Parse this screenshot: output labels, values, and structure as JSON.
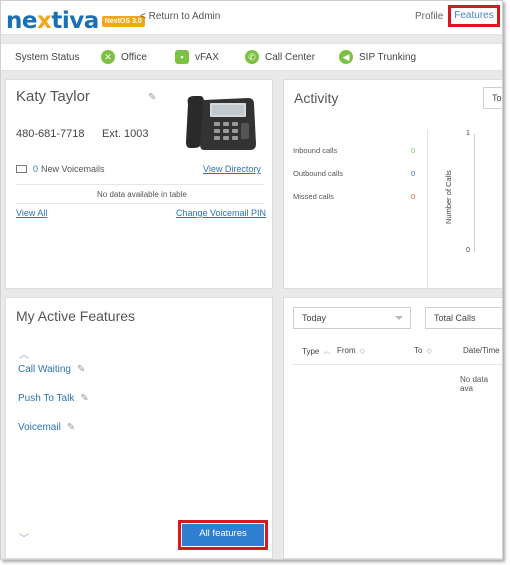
{
  "header": {
    "logo_text_1": "ne",
    "logo_text_x": "x",
    "logo_text_2": "tiva",
    "logo_badge": "NextOS 3.0",
    "return_link": "< Return to Admin",
    "nav_profile": "Profile",
    "nav_features": "Features"
  },
  "statusbar": {
    "label": "System Status",
    "items": [
      {
        "label": "Office",
        "icon": "office-icon"
      },
      {
        "label": "vFAX",
        "icon": "fax-icon"
      },
      {
        "label": "Call Center",
        "icon": "phone-icon"
      },
      {
        "label": "SIP Trunking",
        "icon": "sip-icon"
      }
    ]
  },
  "user": {
    "name": "Katy Taylor",
    "phone": "480-681-7718",
    "ext": "Ext. 1003",
    "view_directory": "View Directory",
    "voicemail_count": "0",
    "voicemail_label": "New Voicemails",
    "no_data": "No data available in table",
    "view_all": "View All",
    "change_pin": "Change Voicemail PIN"
  },
  "activity": {
    "title": "Activity",
    "dropdown": "To",
    "rows": [
      {
        "label": "Inbound calls",
        "value": "0",
        "color": "#7cc142"
      },
      {
        "label": "Outbound calls",
        "value": "0",
        "color": "#2c73b9"
      },
      {
        "label": "Missed calls",
        "value": "0",
        "color": "#e05a2a"
      }
    ],
    "chart_ylabel": "Number of Calls",
    "tick_top": "1",
    "tick_bottom": "0"
  },
  "features": {
    "title": "My Active Features",
    "items": [
      "Call Waiting",
      "Push To Talk",
      "Voicemail"
    ],
    "all_features": "All features"
  },
  "calls": {
    "period": "Today",
    "metric": "Total Calls",
    "col_type": "Type",
    "col_from": "From",
    "col_to": "To",
    "col_date": "Date/Time",
    "no_data": "No data ava"
  },
  "colors": {
    "accent": "#2c73b9",
    "highlight": "#d7191f",
    "status_green": "#7cc142",
    "brand_orange": "#f2a71b"
  }
}
